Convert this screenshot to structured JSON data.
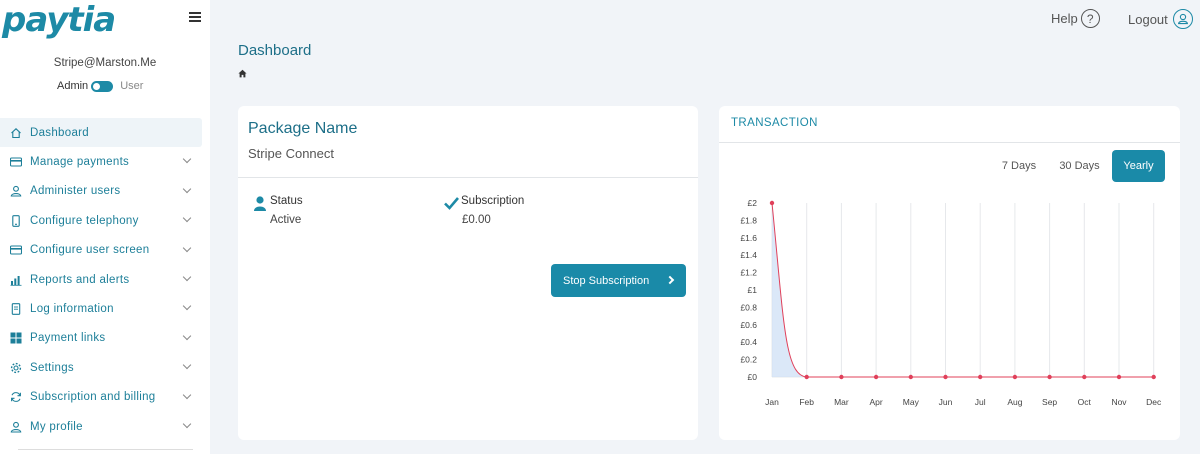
{
  "brand": {
    "logo_text": "paytia",
    "accent": "#1d8aa6"
  },
  "user": {
    "email": "Stripe@Marston.Me",
    "role_admin": "Admin",
    "role_user": "User"
  },
  "sidebar": {
    "items": [
      {
        "label": "Dashboard",
        "icon": "home-icon",
        "active": true
      },
      {
        "label": "Manage payments",
        "icon": "credit-card-icon"
      },
      {
        "label": "Administer users",
        "icon": "user-icon"
      },
      {
        "label": "Configure telephony",
        "icon": "phone-icon"
      },
      {
        "label": "Configure user screen",
        "icon": "card-icon"
      },
      {
        "label": "Reports and alerts",
        "icon": "bar-chart-icon"
      },
      {
        "label": "Log information",
        "icon": "document-icon"
      },
      {
        "label": "Payment links",
        "icon": "grid-icon"
      },
      {
        "label": "Settings",
        "icon": "gear-icon"
      },
      {
        "label": "Subscription and billing",
        "icon": "refresh-icon"
      },
      {
        "label": "My profile",
        "icon": "user-icon"
      }
    ]
  },
  "header": {
    "help": "Help",
    "help_glyph": "?",
    "logout": "Logout"
  },
  "page": {
    "title": "Dashboard"
  },
  "package": {
    "name": "Package Name",
    "subtitle": "Stripe Connect",
    "status_label": "Status",
    "status_value": "Active",
    "subscription_label": "Subscription",
    "subscription_value": "£0.00",
    "stop_button": "Stop Subscription"
  },
  "transaction": {
    "title": "TRANSACTION",
    "ranges": [
      {
        "label": "7 Days",
        "active": false
      },
      {
        "label": "30 Days",
        "active": false
      },
      {
        "label": "Yearly",
        "active": true
      }
    ]
  },
  "chart_data": {
    "type": "line",
    "categories": [
      "Jan",
      "Feb",
      "Mar",
      "Apr",
      "May",
      "Jun",
      "Jul",
      "Aug",
      "Sep",
      "Oct",
      "Nov",
      "Dec"
    ],
    "series": [
      {
        "values": [
          2,
          0,
          0,
          0,
          0,
          0,
          0,
          0,
          0,
          0,
          0,
          0
        ]
      }
    ],
    "yticks": [
      "£0",
      "£0.2",
      "£0.4",
      "£0.6",
      "£0.8",
      "£1",
      "£1.2",
      "£1.4",
      "£1.6",
      "£1.8",
      "£2"
    ],
    "ylim": [
      0,
      2
    ],
    "grid": "vertical",
    "line_color": "#e0405a",
    "fill_color": "#cfe0f5"
  }
}
